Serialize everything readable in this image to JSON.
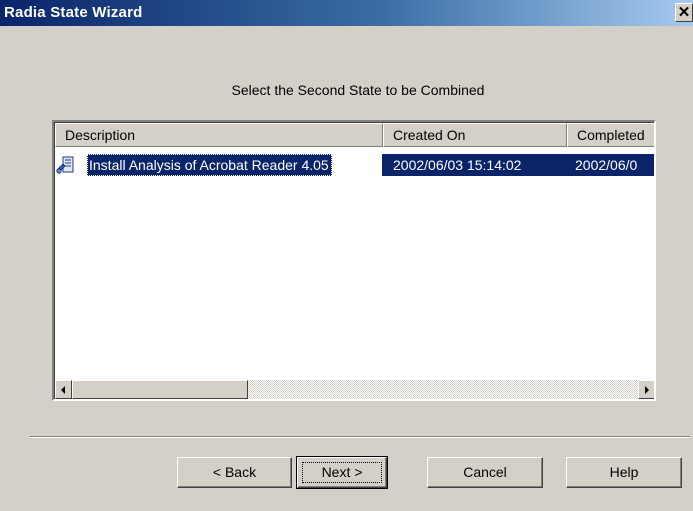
{
  "window": {
    "title": "Radia State Wizard",
    "close_symbol": "✕"
  },
  "instruction": "Select the Second State to be Combined",
  "list": {
    "columns": [
      "Description",
      "Created On",
      "Completed"
    ],
    "rows": [
      {
        "icon": "state-file-icon",
        "description": "Install Analysis of Acrobat Reader 4.05",
        "created_on": "2002/06/03 15:14:02",
        "completed": "2002/06/0",
        "selected": true
      }
    ]
  },
  "buttons": {
    "back": "< Back",
    "next": "Next >",
    "cancel": "Cancel",
    "help": "Help"
  },
  "colors": {
    "title_gradient_start": "#0a246a",
    "title_gradient_end": "#a6caf0",
    "selection": "#0a246a",
    "face": "#d4d0c8"
  }
}
